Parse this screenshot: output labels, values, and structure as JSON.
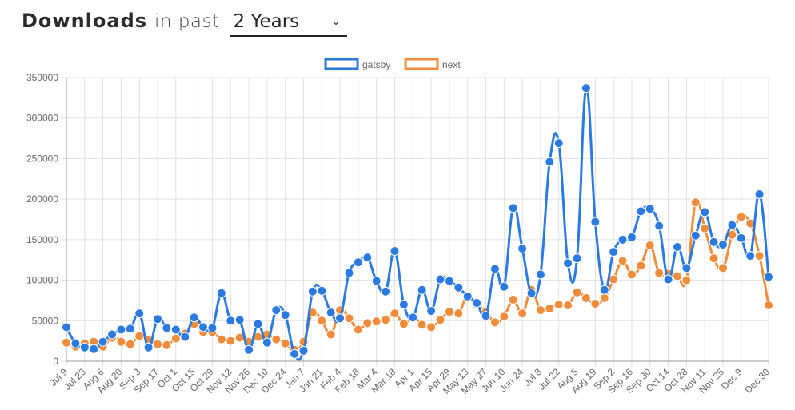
{
  "header": {
    "title_strong": "Downloads",
    "title_light": "in past",
    "period_selected": "2 Years",
    "period_icon": "chevron-down-icon"
  },
  "colors": {
    "gatsby": "#2a7ae2",
    "next": "#f08c3a",
    "grid": "#e0e0e0",
    "axis": "#999999"
  },
  "chart_data": {
    "type": "line",
    "title": "",
    "xlabel": "",
    "ylabel": "",
    "ylim": [
      0,
      350000
    ],
    "yticks": [
      "0",
      "50000",
      "100000",
      "150000",
      "200000",
      "250000",
      "300000",
      "350000"
    ],
    "legend_position": "top-center",
    "grid": true,
    "x": [
      "Jul 9",
      "Jul 16",
      "Jul 23",
      "Jul 30",
      "Aug 6",
      "Aug 13",
      "Aug 20",
      "Aug 27",
      "Sep 3",
      "Sep 10",
      "Sep 17",
      "Sep 24",
      "Oct 1",
      "Oct 8",
      "Oct 15",
      "Oct 22",
      "Oct 29",
      "Nov 5",
      "Nov 12",
      "Nov 19",
      "Nov 26",
      "Dec 3",
      "Dec 10",
      "Dec 17",
      "Dec 24",
      "Dec 31",
      "Jan 7",
      "Jan 14",
      "Jan 21",
      "Jan 28",
      "Feb 4",
      "Feb 11",
      "Feb 18",
      "Feb 25",
      "Mar 4",
      "Mar 11",
      "Mar 18",
      "Mar 25",
      "Apr 1",
      "Apr 8",
      "Apr 15",
      "Apr 22",
      "Apr 29",
      "May 6",
      "May 13",
      "May 20",
      "May 27",
      "Jun 3",
      "Jun 10",
      "Jun 17",
      "Jun 24",
      "Jul 1",
      "Jul 8",
      "Jul 15",
      "Jul 22",
      "Jul 29",
      "Aug 5",
      "Aug 12",
      "Aug 19",
      "Aug 26",
      "Sep 2",
      "Sep 9",
      "Sep 16",
      "Sep 23",
      "Sep 30",
      "Oct 7",
      "Oct 14",
      "Oct 21",
      "Oct 28",
      "Nov 4",
      "Nov 11",
      "Nov 18",
      "Nov 25",
      "Dec 2",
      "Dec 9",
      "Dec 16",
      "Dec 23",
      "Dec 30"
    ],
    "xticks": [
      "Jul 9",
      "Jul 23",
      "Aug 6",
      "Aug 20",
      "Sep 3",
      "Sep 17",
      "Oct 1",
      "Oct 15",
      "Oct 29",
      "Nov 12",
      "Nov 26",
      "Dec 10",
      "Dec 24",
      "Jan 7",
      "Jan 21",
      "Feb 4",
      "Feb 18",
      "Mar 4",
      "Mar 18",
      "Apr 1",
      "Apr 15",
      "Apr 29",
      "May 13",
      "May 27",
      "Jun 10",
      "Jun 24",
      "Jul 8",
      "Jul 22",
      "Aug 5",
      "Aug 19",
      "Sep 2",
      "Sep 16",
      "Sep 30",
      "Oct 14",
      "Oct 28",
      "Nov 11",
      "Nov 25",
      "Dec 9",
      "Dec 30"
    ],
    "series": [
      {
        "name": "gatsby",
        "color": "#2a7ae2",
        "values": [
          42000,
          22000,
          17000,
          15000,
          24000,
          33000,
          39000,
          40000,
          59000,
          17000,
          52000,
          41000,
          39000,
          30000,
          54000,
          42000,
          41000,
          84000,
          50000,
          51000,
          14000,
          46000,
          23000,
          63000,
          57000,
          9000,
          13000,
          86000,
          87000,
          60000,
          53000,
          109000,
          122000,
          128000,
          99000,
          86000,
          136000,
          70000,
          54000,
          88000,
          62000,
          101000,
          99000,
          91000,
          80000,
          72000,
          56000,
          114000,
          92000,
          189000,
          139000,
          84000,
          107000,
          246000,
          269000,
          121000,
          127000,
          337000,
          172000,
          88000,
          135000,
          150000,
          153000,
          185000,
          188000,
          167000,
          101000,
          141000,
          115000,
          155000,
          184000,
          147000,
          144000,
          168000,
          152000,
          130000,
          206000,
          104000
        ]
      },
      {
        "name": "next",
        "color": "#f08c3a",
        "values": [
          23000,
          18000,
          22000,
          24000,
          18000,
          29000,
          24000,
          21000,
          31000,
          26000,
          21000,
          20000,
          28000,
          34000,
          46000,
          36000,
          36000,
          27000,
          25000,
          29000,
          24000,
          30000,
          33000,
          27000,
          22000,
          14000,
          24000,
          60000,
          50000,
          33000,
          63000,
          53000,
          39000,
          47000,
          49000,
          51000,
          59000,
          46000,
          54000,
          45000,
          42000,
          51000,
          61000,
          59000,
          81000,
          70000,
          61000,
          48000,
          55000,
          76000,
          59000,
          88000,
          63000,
          65000,
          70000,
          69000,
          85000,
          78000,
          71000,
          78000,
          101000,
          124000,
          107000,
          118000,
          143000,
          109000,
          108000,
          105000,
          100000,
          196000,
          164000,
          127000,
          115000,
          156000,
          178000,
          170000,
          130000,
          69000
        ]
      }
    ]
  }
}
